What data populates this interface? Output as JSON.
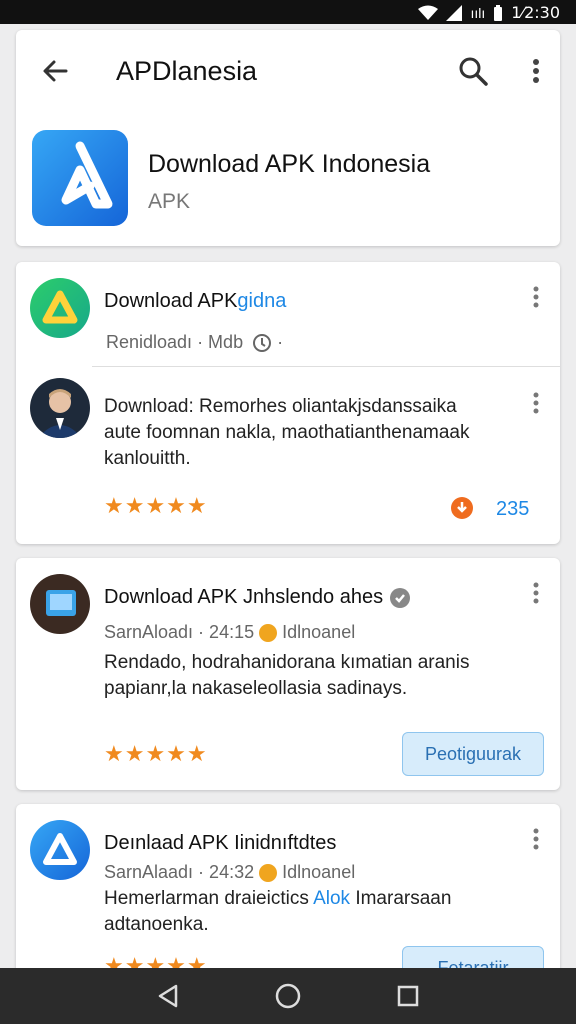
{
  "status_bar": {
    "time": "1⁄2:30",
    "signal_label": "ıılı"
  },
  "app_bar": {
    "title": "APDlanesia"
  },
  "app_header": {
    "name": "Download APK Indonesia",
    "type": "APK"
  },
  "cards": [
    {
      "title": "Download APK",
      "title_accent": "gidna",
      "meta": "Renidloadı · Mdb",
      "meta_suffix": "·",
      "comment": {
        "title": "Download: Remorhes oliantakjsdanssaika",
        "text": "aute foomnan nakla, maothatianthenamaak kanlouitth.",
        "stars": "★★★★★",
        "count": "235"
      }
    },
    {
      "title": "Download APK Jnhslendo ahes",
      "meta_left": "SarnAloadı · 24:15",
      "meta_right": "Idlnoanel",
      "text": "Rendado, hodrahanidorana kımatian aranis papianr,la nakaseleollasia sadinays.",
      "stars": "★★★★★",
      "button": "Peotiguurak"
    },
    {
      "title": "Deınlaad APK Iinidnıftdtes",
      "meta_left": "SarnAlaadı · 24:32",
      "meta_right": "Idlnoanel",
      "text_a": "Hemerlarman draieictics",
      "text_b": "Alok",
      "text_c": "Imararsaan adtanoenka.",
      "stars": "★★★★★",
      "button": "Fetaratiir"
    }
  ],
  "colors": {
    "accent": "#1e88e5",
    "star": "#f08a1f",
    "badge": "#f0a51f",
    "button_bg": "#d7ecfb"
  }
}
